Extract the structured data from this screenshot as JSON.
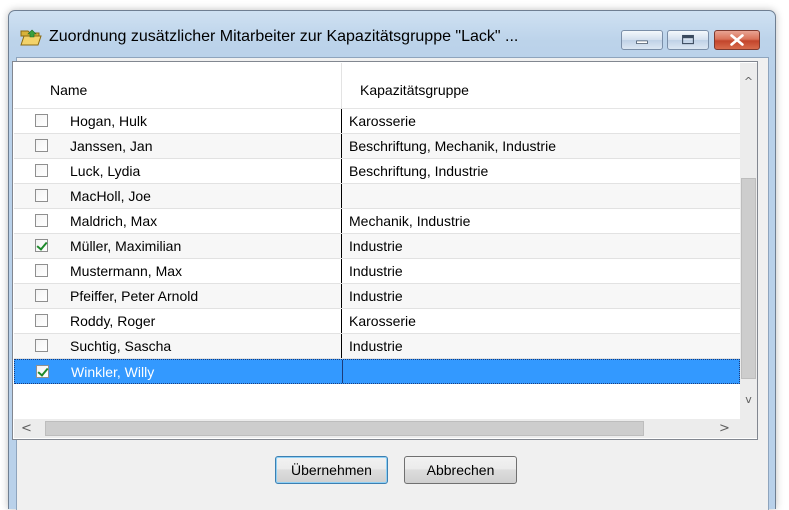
{
  "window": {
    "title": "Zuordnung zusätzlicher Mitarbeiter zur Kapazitätsgruppe \"Lack\" ...",
    "icon": "folder-open-icon",
    "controls": [
      "minimize-icon",
      "maximize-icon",
      "close-icon"
    ]
  },
  "list": {
    "columns": {
      "name": "Name",
      "group": "Kapazitätsgruppe"
    },
    "rows": [
      {
        "name": "Hogan, Hulk",
        "group": "Karosserie",
        "checked": false
      },
      {
        "name": "Janssen, Jan",
        "group": "Beschriftung, Mechanik, Industrie",
        "checked": false
      },
      {
        "name": "Luck, Lydia",
        "group": "Beschriftung, Industrie",
        "checked": false
      },
      {
        "name": "MacHoll, Joe",
        "group": "",
        "checked": false
      },
      {
        "name": "Maldrich, Max",
        "group": "Mechanik, Industrie",
        "checked": false
      },
      {
        "name": "Müller, Maximilian",
        "group": "Industrie",
        "checked": true
      },
      {
        "name": "Mustermann, Max",
        "group": "Industrie",
        "checked": false
      },
      {
        "name": "Pfeiffer, Peter Arnold",
        "group": "Industrie",
        "checked": false
      },
      {
        "name": "Roddy, Roger",
        "group": "Karosserie",
        "checked": false
      },
      {
        "name": "Suchtig, Sascha",
        "group": "Industrie",
        "checked": false
      },
      {
        "name": "Winkler, Willy",
        "group": "",
        "checked": true,
        "selected": true
      }
    ]
  },
  "scrollbars": {
    "up_arrow": "^",
    "down_arrow": "v",
    "left_arrow": "<",
    "right_arrow": ">"
  },
  "buttons": {
    "ok": "Übernehmen",
    "cancel": "Abbrechen"
  },
  "colors": {
    "selection": "#3399ff",
    "check": "#1e8a2c",
    "close_button": "#c3452b"
  }
}
